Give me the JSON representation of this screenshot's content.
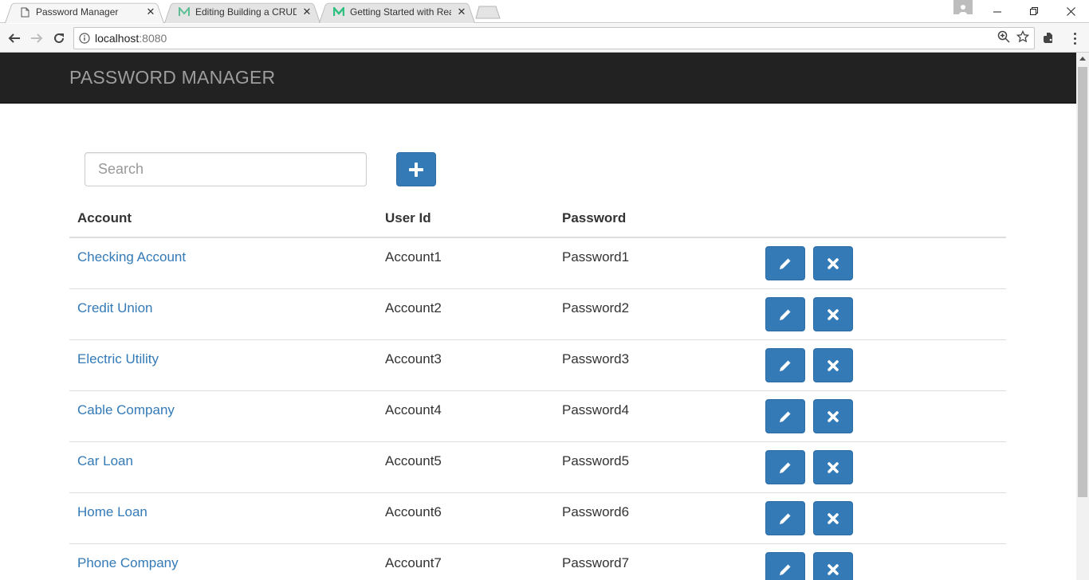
{
  "browser": {
    "tabs": [
      {
        "title": "Password Manager",
        "active": true,
        "favicon": "page-icon"
      },
      {
        "title": "Editing Building a CRUD",
        "active": false,
        "favicon": "medium-icon"
      },
      {
        "title": "Getting Started with Rea",
        "active": false,
        "favicon": "medium-icon"
      }
    ],
    "url_host": "localhost",
    "url_port": ":8080"
  },
  "app": {
    "brand": "PASSWORD MANAGER",
    "search_placeholder": "Search",
    "columns": {
      "account": "Account",
      "user_id": "User Id",
      "password": "Password"
    },
    "rows": [
      {
        "account": "Checking Account",
        "user_id": "Account1",
        "password": "Password1"
      },
      {
        "account": "Credit Union",
        "user_id": "Account2",
        "password": "Password2"
      },
      {
        "account": "Electric Utility",
        "user_id": "Account3",
        "password": "Password3"
      },
      {
        "account": "Cable Company",
        "user_id": "Account4",
        "password": "Password4"
      },
      {
        "account": "Car Loan",
        "user_id": "Account5",
        "password": "Password5"
      },
      {
        "account": "Home Loan",
        "user_id": "Account6",
        "password": "Password6"
      },
      {
        "account": "Phone Company",
        "user_id": "Account7",
        "password": "Password7"
      }
    ]
  },
  "colors": {
    "primary": "#337ab7",
    "navbar": "#222222",
    "brand_text": "#9d9d9d",
    "link": "#337ab7"
  }
}
